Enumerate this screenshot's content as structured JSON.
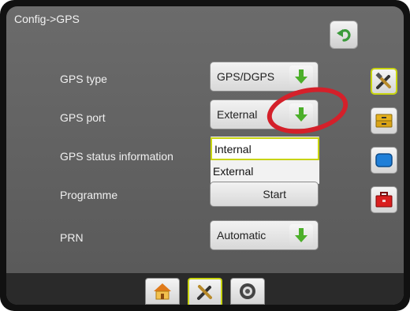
{
  "header": {
    "title": "Config->GPS"
  },
  "settings": {
    "gps_type": {
      "label": "GPS type",
      "value": "GPS/DGPS"
    },
    "gps_port": {
      "label": "GPS port",
      "value": "External"
    },
    "gps_status": {
      "label": "GPS status information"
    },
    "programme": {
      "label": "Programme",
      "value": "Start"
    },
    "prn": {
      "label": "PRN",
      "value": "Automatic"
    }
  },
  "port_dropdown": {
    "options": [
      "Internal",
      "External"
    ],
    "selected": "Internal"
  },
  "colors": {
    "accent": "#c8d40f",
    "arrow_green": "#4caf2a",
    "highlight_ring": "#d4202a"
  },
  "icons": {
    "back": "undo-arrow-icon",
    "sidebar": [
      "tools-icon",
      "storage-drawer-icon",
      "display-screen-icon",
      "toolbox-icon"
    ],
    "bottom": [
      "home-icon",
      "tools-icon",
      "wheel-icon"
    ]
  }
}
